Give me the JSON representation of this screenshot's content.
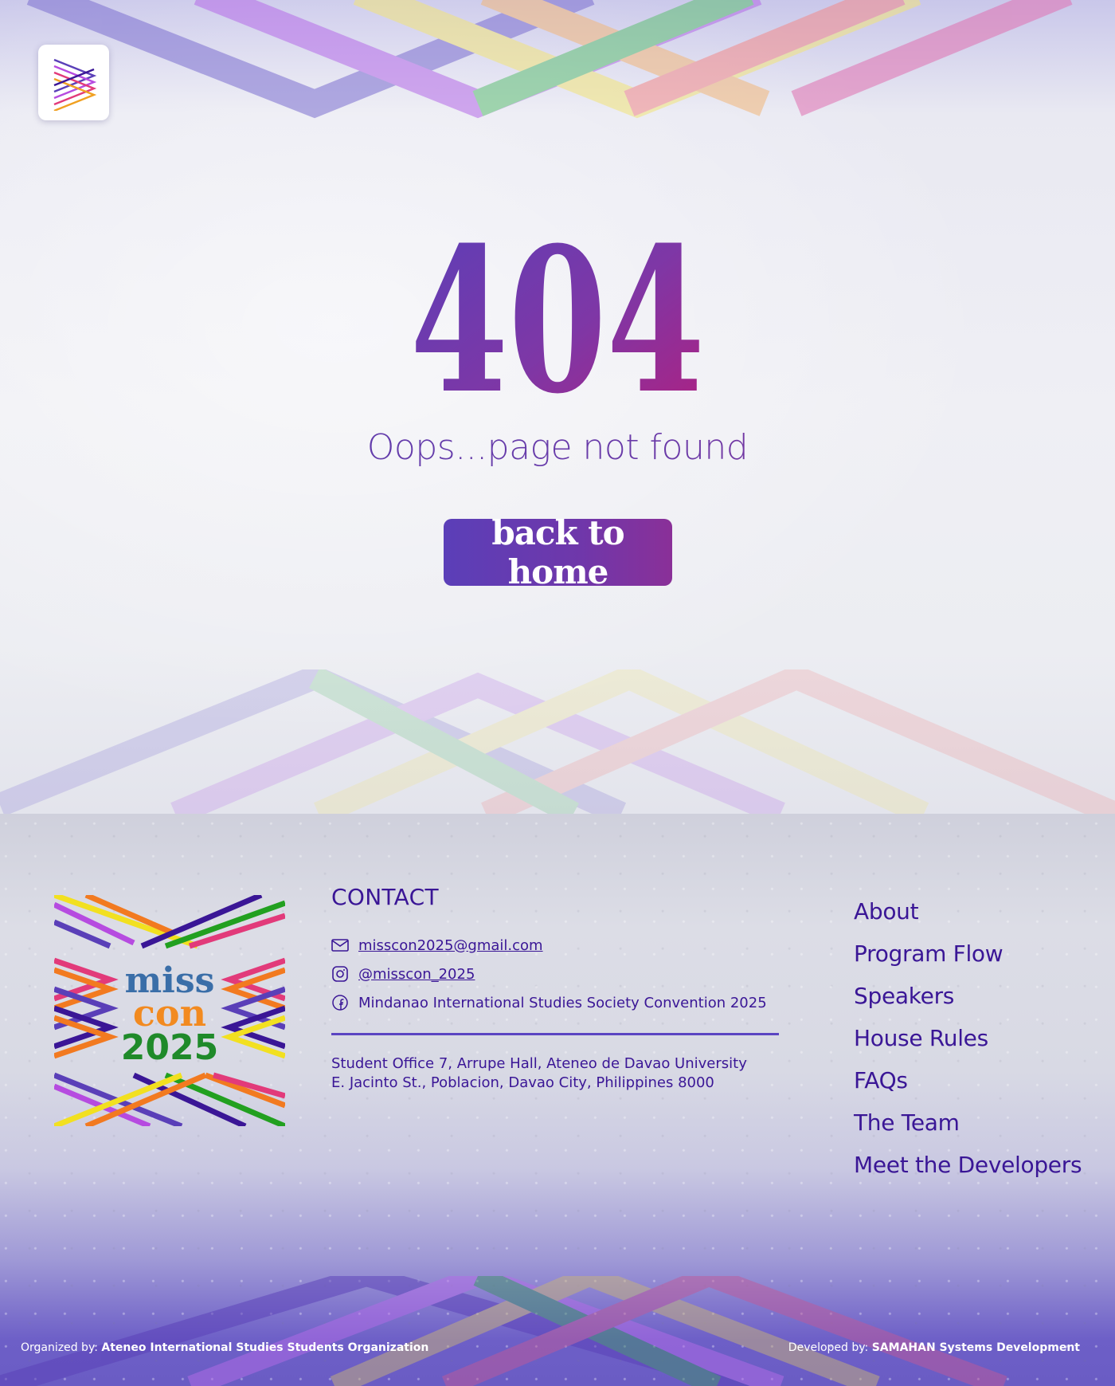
{
  "error": {
    "code": "404",
    "message": "Oops...page not found",
    "home_button": "back to home"
  },
  "contact": {
    "heading": "CONTACT",
    "email": "misscon2025@gmail.com",
    "instagram": "@misscon_2025",
    "facebook": "Mindanao International Studies Society Convention 2025",
    "address_line1": "Student Office 7, Arrupe Hall, Ateneo de Davao University",
    "address_line2": "E. Jacinto St., Poblacion, Davao City, Philippines 8000"
  },
  "logo": {
    "line1": "miss",
    "line2": "con",
    "line3": "2025"
  },
  "nav": {
    "items": [
      "About",
      "Program Flow",
      "Speakers",
      "House Rules",
      "FAQs",
      "The Team",
      "Meet the Developers"
    ]
  },
  "credits": {
    "organized_prefix": "Organized by:",
    "organized_name": "Ateneo International Studies Students Organization",
    "developed_prefix": "Developed by:",
    "developed_name": "SAMAHAN Systems Development"
  },
  "colors": {
    "primary": "#3a1696",
    "accent_purple": "#5b3fb8",
    "accent_magenta": "#a0207f",
    "stripe_palette": [
      "#7c6fd0",
      "#b56be8",
      "#f2e47a",
      "#5fbf74",
      "#f28a8a",
      "#f2a060",
      "#e070b0"
    ]
  },
  "icons": {
    "email": "mail-icon",
    "instagram": "instagram-icon",
    "facebook": "facebook-icon",
    "app_logo": "stripes-logo-icon"
  }
}
